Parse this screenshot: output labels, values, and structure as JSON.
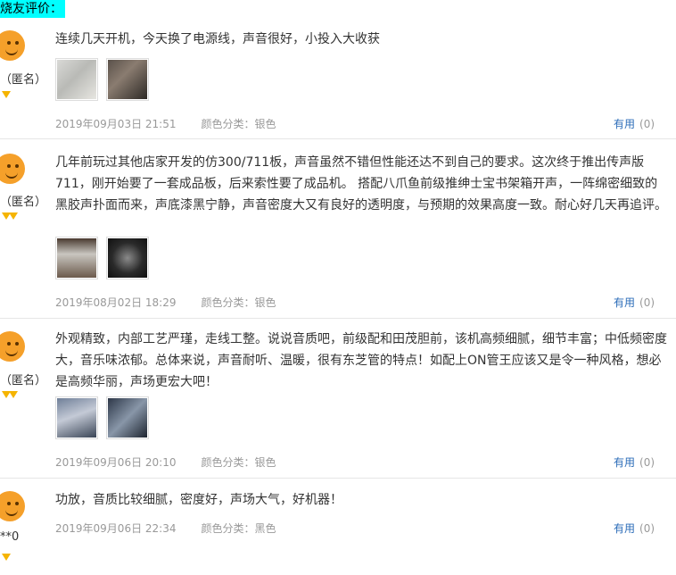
{
  "section_title": "烧友评价：",
  "reviews": [
    {
      "user": "（匿名）",
      "content": "连续几天开机，今天换了电源线，声音很好，小投入大收获",
      "date": "2019年09月03日 21:51",
      "sku": "颜色分类：银色",
      "useful_label": "有用",
      "useful_count": "(0)"
    },
    {
      "user": "（匿名）",
      "content": "几年前玩过其他店家开发的仿300/711板，声音虽然不错但性能还达不到自己的要求。这次终于推出传声版711，刚开始要了一套成品板，后来索性要了成品机。 搭配八爪鱼前级推绅士宝书架箱开声，一阵绵密细致的黑胶声扑面而来，声底漆黑宁静，声音密度大又有良好的透明度，与预期的效果高度一致。耐心好几天再追评。",
      "date": "2019年08月02日 18:29",
      "sku": "颜色分类：银色",
      "useful_label": "有用",
      "useful_count": "(0)"
    },
    {
      "user": "（匿名）",
      "content": "外观精致，内部工艺严瑾，走线工整。说说音质吧，前级配和田茂胆前，该机高频细腻，细节丰富；中低频密度大，音乐味浓郁。总体来说，声音耐听、温暖，很有东芝管的特点！如配上ON管王应该又是令一种风格，想必是高频华丽，声场更宏大吧！",
      "date": "2019年09月06日 20:10",
      "sku": "颜色分类：银色",
      "useful_label": "有用",
      "useful_count": "(0)"
    },
    {
      "user": "**0",
      "content": "功放，音质比较细腻，密度好，声场大气，好机器！",
      "date": "2019年09月06日 22:34",
      "sku": "颜色分类：黑色",
      "useful_label": "有用",
      "useful_count": "(0)"
    }
  ]
}
